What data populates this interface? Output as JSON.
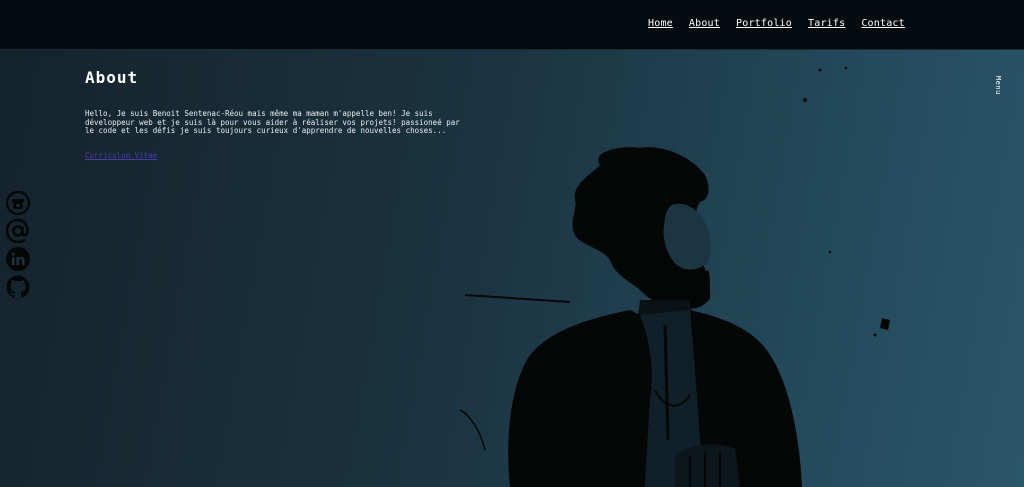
{
  "nav": {
    "items": [
      "Home",
      "About",
      "Portfolio",
      "Tarifs",
      "Contact"
    ]
  },
  "about": {
    "title": "About",
    "text": "Hello, Je suis Benoit Sentenac-Réou mais même ma maman m'appelle ben! Je suis développeur web et je suis là pour vous aider à réaliser vos projets! passioneé par le code et les défis je suis toujours curieux d'apprendre de nouvelles choses...",
    "cv_link": "Curriculum Vitae"
  },
  "menu": {
    "label": "Menu"
  },
  "social": {
    "icons": [
      "phone-icon",
      "at-icon",
      "linkedin-icon",
      "github-icon"
    ]
  },
  "colors": {
    "topbar": "#050b0e",
    "background_start": "#14232c",
    "background_end": "#2a5669",
    "link_visited": "#4b3aa8",
    "text": "#ffffff"
  }
}
